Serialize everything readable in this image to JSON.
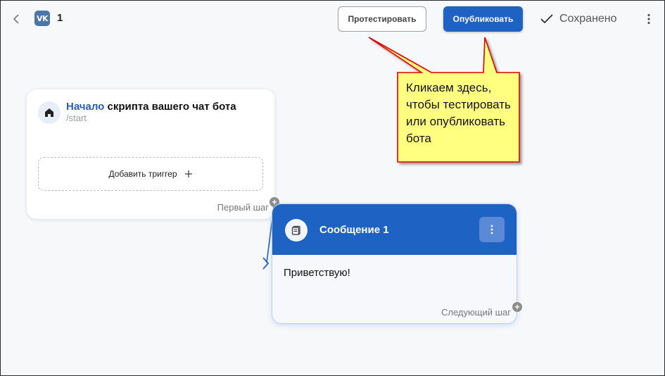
{
  "header": {
    "back_icon": "chevron-left-icon",
    "logo_text": "VK",
    "bot_name": "1",
    "test_button": "Протестировать",
    "publish_button": "Опубликовать",
    "saved_label": "Сохранено",
    "more_icon": "more-vertical-icon"
  },
  "start_node": {
    "title_accent": "Начало",
    "title_rest": " скрипта вашего чат бота",
    "command": "/start",
    "add_trigger_label": "Добавить триггер",
    "add_icon": "plus-icon",
    "step_label": "Первый шаг"
  },
  "message_node": {
    "title": "Сообщение 1",
    "text": "Приветствую!",
    "step_label": "Следующий шаг"
  },
  "annotation": {
    "text": "Кликаем здесь, чтобы тестировать или опубликовать бота",
    "fill": "#ffff80",
    "border": "#e00000"
  },
  "colors": {
    "primary": "#1e63c4",
    "accent_text": "#2a5fb0"
  }
}
